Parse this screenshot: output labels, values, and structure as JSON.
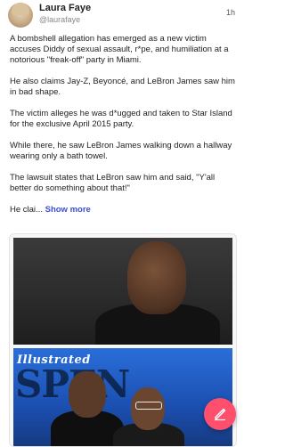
{
  "post": {
    "author_name": "Laura Faye",
    "author_handle": "@laurafaye",
    "time": "1h",
    "paragraphs": [
      "A bombshell allegation has emerged as a new victim accuses Diddy of sexual assault, r*pe, and humiliation at a notorious \"freak-off\" party in Miami.",
      "He also claims Jay-Z, Beyoncé, and LeBron James saw him in bad shape.",
      "The victim alleges he was d*ugged and taken to Star Island for the exclusive April 2015 party.",
      "While there, he saw LeBron James walking down a hallway wearing only a bath towel.",
      "The lawsuit states that LeBron saw him and said, \"Y'all better do something about that!\""
    ],
    "truncated_text": "He clai...",
    "show_more_label": "Show more"
  },
  "media": {
    "image2_banner": "Illustrated",
    "image2_bigword": "SPEN"
  },
  "icons": {
    "avatar": "avatar",
    "compose": "pencil-icon"
  },
  "colors": {
    "link": "#3a4fd6",
    "compose_button": "#ff4f6d"
  }
}
